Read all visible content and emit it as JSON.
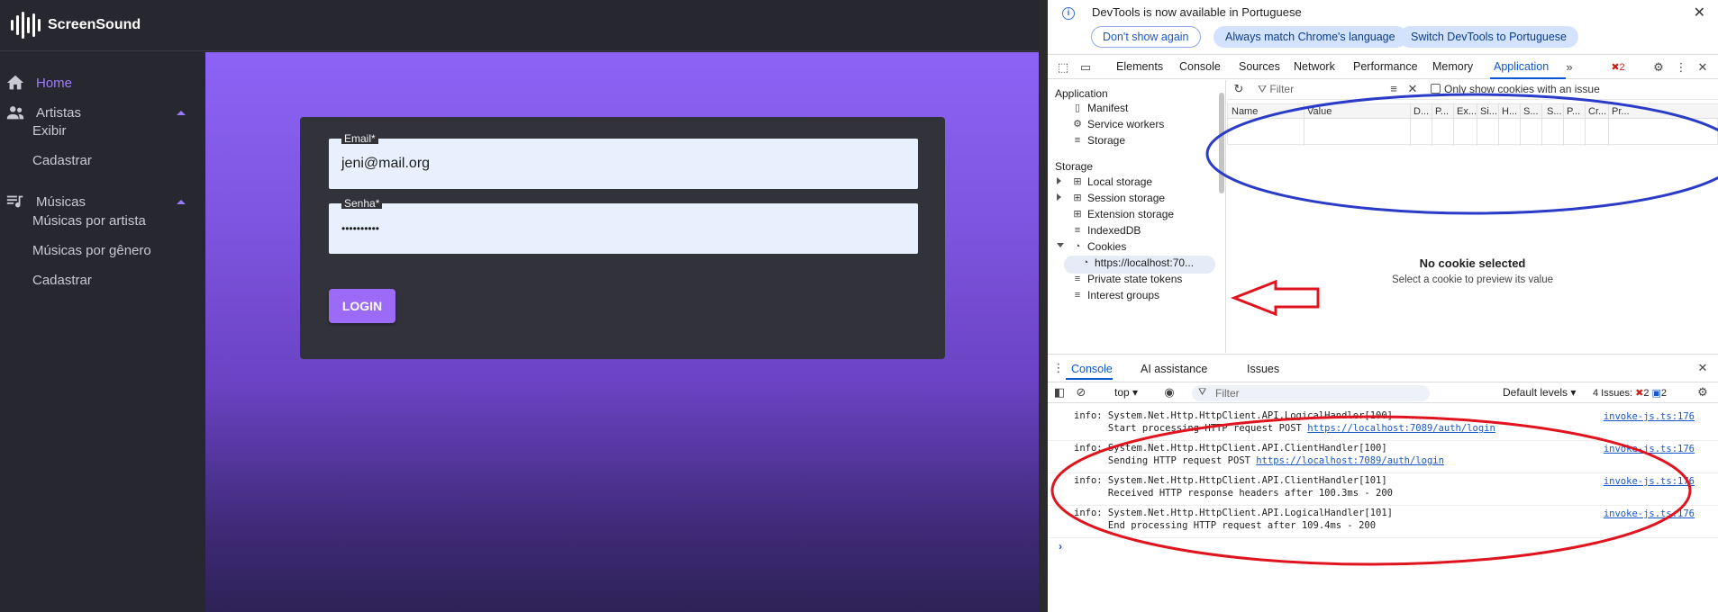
{
  "app": {
    "logo_text": "ScreenSound",
    "nav": {
      "home": "Home",
      "artistas": "Artistas",
      "exibir": "Exibir",
      "cadastrar_artista": "Cadastrar",
      "musicas": "Músicas",
      "musicas_por_artista": "Músicas por artista",
      "musicas_por_genero": "Músicas por gênero",
      "cadastrar_musica": "Cadastrar"
    },
    "form": {
      "email_label": "Email*",
      "email_value": "jeni@mail.org",
      "senha_label": "Senha*",
      "senha_value": "••••••••••",
      "login_button": "LOGIN"
    },
    "accent_color": "#9b6af6"
  },
  "devtools": {
    "infobar": {
      "message": "DevTools is now available in Portuguese",
      "dont_show": "Don't show again",
      "match_language": "Always match Chrome's language",
      "switch_language": "Switch DevTools to Portuguese"
    },
    "tabs": [
      "Elements",
      "Console",
      "Sources",
      "Network",
      "Performance",
      "Memory",
      "Application"
    ],
    "active_tab": "Application",
    "error_badge": "2",
    "sidebar": {
      "application_header": "Application",
      "manifest": "Manifest",
      "service_workers": "Service workers",
      "storage_item": "Storage",
      "storage_header": "Storage",
      "local_storage": "Local storage",
      "session_storage": "Session storage",
      "extension_storage": "Extension storage",
      "indexeddb": "IndexedDB",
      "cookies": "Cookies",
      "cookie_origin": "https://localhost:70...",
      "private_state_tokens": "Private state tokens",
      "interest_groups": "Interest groups"
    },
    "cookies": {
      "filter_placeholder": "Filter",
      "only_issue_label": "Only show cookies with an issue",
      "columns": [
        "Name",
        "Value",
        "D...",
        "P...",
        "Ex...",
        "Si...",
        "H...",
        "S...",
        "S...",
        "P...",
        "Cr...",
        "Pr..."
      ],
      "empty_title": "No cookie selected",
      "empty_subtitle": "Select a cookie to preview its value"
    },
    "drawer": {
      "tabs": [
        "Console",
        "AI assistance",
        "Issues"
      ],
      "context": "top",
      "filter_placeholder": "Filter",
      "levels": "Default levels",
      "issues_label": "4 Issues:",
      "issues_errors": "2",
      "issues_info": "2"
    },
    "logs": [
      {
        "line1": "info: System.Net.Http.HttpClient.API.LogicalHandler[100]",
        "line2_prefix": "      Start processing HTTP request POST ",
        "line2_link": "https://localhost:7089/auth/login",
        "source": "invoke-js.ts:176"
      },
      {
        "line1": "info: System.Net.Http.HttpClient.API.ClientHandler[100]",
        "line2_prefix": "      Sending HTTP request POST ",
        "line2_link": "https://localhost:7089/auth/login",
        "source": "invoke-js.ts:176"
      },
      {
        "line1": "info: System.Net.Http.HttpClient.API.ClientHandler[101]",
        "line2_prefix": "      Received HTTP response headers after 100.3ms - 200",
        "line2_link": "",
        "source": "invoke-js.ts:176"
      },
      {
        "line1": "info: System.Net.Http.HttpClient.API.LogicalHandler[101]",
        "line2_prefix": "      End processing HTTP request after 109.4ms - 200",
        "line2_link": "",
        "source": "invoke-js.ts:176"
      }
    ]
  },
  "annotations": {
    "blue_ellipse_color": "#2a3bc8",
    "red_color": "#e0141e"
  }
}
